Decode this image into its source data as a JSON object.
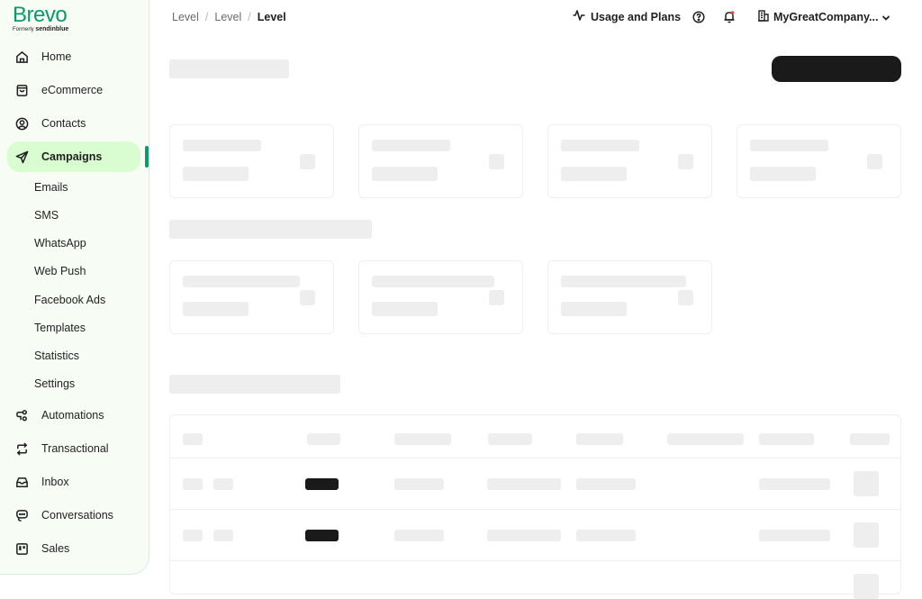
{
  "brand": {
    "name": "Brevo",
    "formerly_prefix": "Formerly",
    "formerly_name": "sendinblue",
    "accent": "#0b996e",
    "active_bg": "#d9fcd0"
  },
  "sidebar": {
    "items": [
      {
        "label": "Home",
        "icon": "home-icon"
      },
      {
        "label": "eCommerce",
        "icon": "shopping-bag-icon"
      },
      {
        "label": "Contacts",
        "icon": "user-circle-icon"
      },
      {
        "label": "Campaigns",
        "icon": "paper-plane-icon",
        "active": true
      },
      {
        "label": "Automations",
        "icon": "automation-icon"
      },
      {
        "label": "Transactional",
        "icon": "repeat-icon"
      },
      {
        "label": "Inbox",
        "icon": "inbox-icon"
      },
      {
        "label": "Conversations",
        "icon": "chat-icon"
      },
      {
        "label": "Sales",
        "icon": "kanban-icon"
      }
    ],
    "campaign_subitems": [
      "Emails",
      "SMS",
      "WhatsApp",
      "Web Push",
      "Facebook Ads",
      "Templates",
      "Statistics",
      "Settings"
    ]
  },
  "breadcrumb": [
    "Level",
    "Level",
    "Level"
  ],
  "breadcrumb_separator": "/",
  "topbar": {
    "usage_label": "Usage and Plans",
    "company_label": "MyGreatCompany...",
    "notification_dot_color": "#e5484d"
  }
}
